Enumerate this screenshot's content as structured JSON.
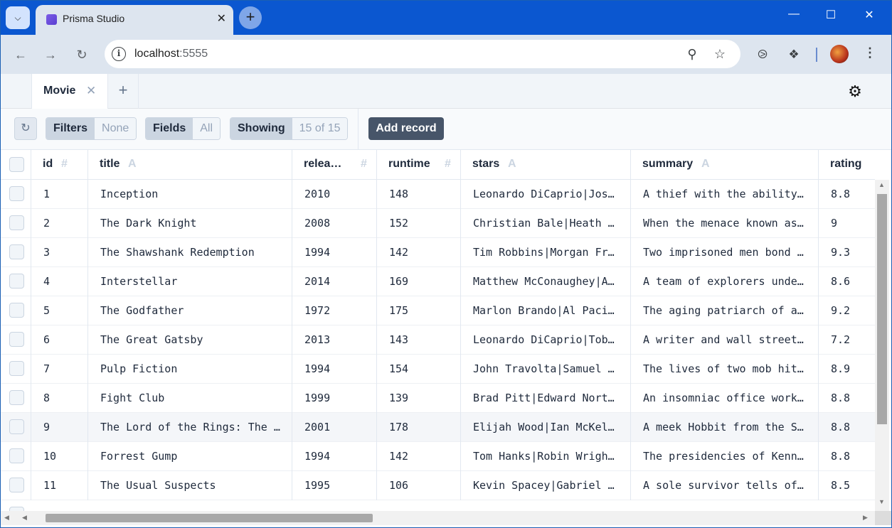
{
  "browser": {
    "tab_title": "Prisma Studio",
    "url_host": "localhost",
    "url_port": ":5555"
  },
  "studio": {
    "open_tab": "Movie",
    "controls": {
      "filters_label": "Filters",
      "filters_value": "None",
      "fields_label": "Fields",
      "fields_value": "All",
      "showing_label": "Showing",
      "showing_value": "15 of 15",
      "add_record": "Add record"
    }
  },
  "columns": [
    {
      "name": "id",
      "type": "#"
    },
    {
      "name": "title",
      "type": "A"
    },
    {
      "name": "relea…",
      "type": "#"
    },
    {
      "name": "runtime",
      "type": "#"
    },
    {
      "name": "stars",
      "type": "A"
    },
    {
      "name": "summary",
      "type": "A"
    },
    {
      "name": "rating",
      "type": "#"
    }
  ],
  "rows": [
    [
      "1",
      "Inception",
      "2010",
      "148",
      "Leonardo DiCaprio|Jos…",
      "A thief with the ability…",
      "8.8"
    ],
    [
      "2",
      "The Dark Knight",
      "2008",
      "152",
      "Christian Bale|Heath …",
      "When the menace known as…",
      "9"
    ],
    [
      "3",
      "The Shawshank Redemption",
      "1994",
      "142",
      "Tim Robbins|Morgan Fr…",
      "Two imprisoned men bond …",
      "9.3"
    ],
    [
      "4",
      "Interstellar",
      "2014",
      "169",
      "Matthew McConaughey|A…",
      "A team of explorers unde…",
      "8.6"
    ],
    [
      "5",
      "The Godfather",
      "1972",
      "175",
      "Marlon Brando|Al Paci…",
      "The aging patriarch of a…",
      "9.2"
    ],
    [
      "6",
      "The Great Gatsby",
      "2013",
      "143",
      "Leonardo DiCaprio|Tob…",
      "A writer and wall street…",
      "7.2"
    ],
    [
      "7",
      "Pulp Fiction",
      "1994",
      "154",
      "John Travolta|Samuel …",
      "The lives of two mob hit…",
      "8.9"
    ],
    [
      "8",
      "Fight Club",
      "1999",
      "139",
      "Brad Pitt|Edward Nort…",
      "An insomniac office work…",
      "8.8"
    ],
    [
      "9",
      "The Lord of the Rings: The …",
      "2001",
      "178",
      "Elijah Wood|Ian McKel…",
      "A meek Hobbit from the S…",
      "8.8"
    ],
    [
      "10",
      "Forrest Gump",
      "1994",
      "142",
      "Tom Hanks|Robin Wrigh…",
      "The presidencies of Kenn…",
      "8.8"
    ],
    [
      "11",
      "The Usual Suspects",
      "1995",
      "106",
      "Kevin Spacey|Gabriel …",
      "A sole survivor tells of…",
      "8.5"
    ]
  ],
  "highlighted_row": 8,
  "icons": {
    "tab_menu": "chevron-down-icon",
    "settings": "gear-icon",
    "info": "site-info-icon"
  }
}
